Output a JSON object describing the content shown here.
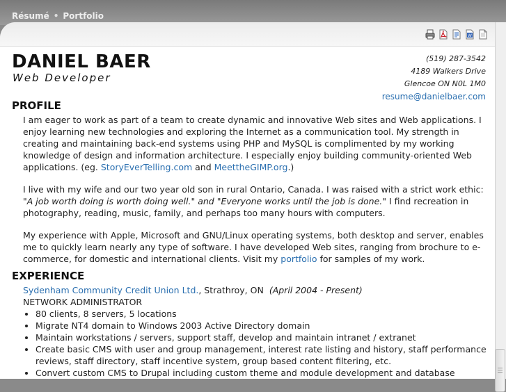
{
  "nav": {
    "resume": "Résumé",
    "separator": "•",
    "portfolio": "Portfolio"
  },
  "toolbar": {
    "icons": [
      "printer-icon",
      "pdf-icon",
      "text-document-icon",
      "word-document-icon",
      "plain-document-icon"
    ]
  },
  "header": {
    "name": "DANIEL BAER",
    "role": "Web Developer",
    "phone": "(519) 287-3542",
    "address1": "4189 Walkers Drive",
    "address2": "Glencoe ON N0L 1M0",
    "email": "resume@danielbaer.com"
  },
  "profile": {
    "title": "PROFILE",
    "p1_text": "I am eager to work as part of a team to create dynamic and innovative Web sites and Web applications. I enjoy learning new technologies and exploring the Internet as a communication tool. My strength in creating and maintaining back-end systems using PHP and MySQL is complimented by my working knowledge of design and information architecture. I especially enjoy building community-oriented Web applications. (eg. ",
    "p1_link1": "StoryEverTelling.com",
    "p1_and": " and ",
    "p1_link2": "MeettheGIMP.org",
    "p1_end": ".)",
    "p2_text": "I live with my wife and our two year old son in rural Ontario, Canada. I was raised with a strict work ethic: ",
    "p2_quote": "\"A job worth doing is worth doing well.\" and \"Everyone works until the job is done.\"",
    "p2_end": " I find recreation in photography, reading, music, family, and perhaps too many hours with computers.",
    "p3_text": "My experience with Apple, Microsoft and GNU/Linux operating systems, both desktop and server, enables me to quickly learn nearly any type of software. I have developed Web sites, ranging from brochure to e-commerce, for domestic and international clients. Visit my ",
    "p3_link": "portfolio",
    "p3_end": " for samples of my work."
  },
  "experience": {
    "title": "EXPERIENCE",
    "employer": "Sydenham Community Credit Union Ltd.",
    "location": ", Strathroy, ON",
    "dates": "(April 2004 - Present)",
    "position": "NETWORK ADMINISTRATOR",
    "duties": [
      "80 clients, 8 servers, 5 locations",
      "Migrate NT4 domain to Windows 2003 Active Directory domain",
      "Maintain workstations / servers, support staff, develop and maintain intranet / extranet",
      "Create basic CMS with user and group management, interest rate listing and history, staff performance reviews, staff directory, staff incentive system, group based content filtering, etc.",
      "Convert custom CMS to Drupal including custom theme and module development and database conversion."
    ]
  }
}
